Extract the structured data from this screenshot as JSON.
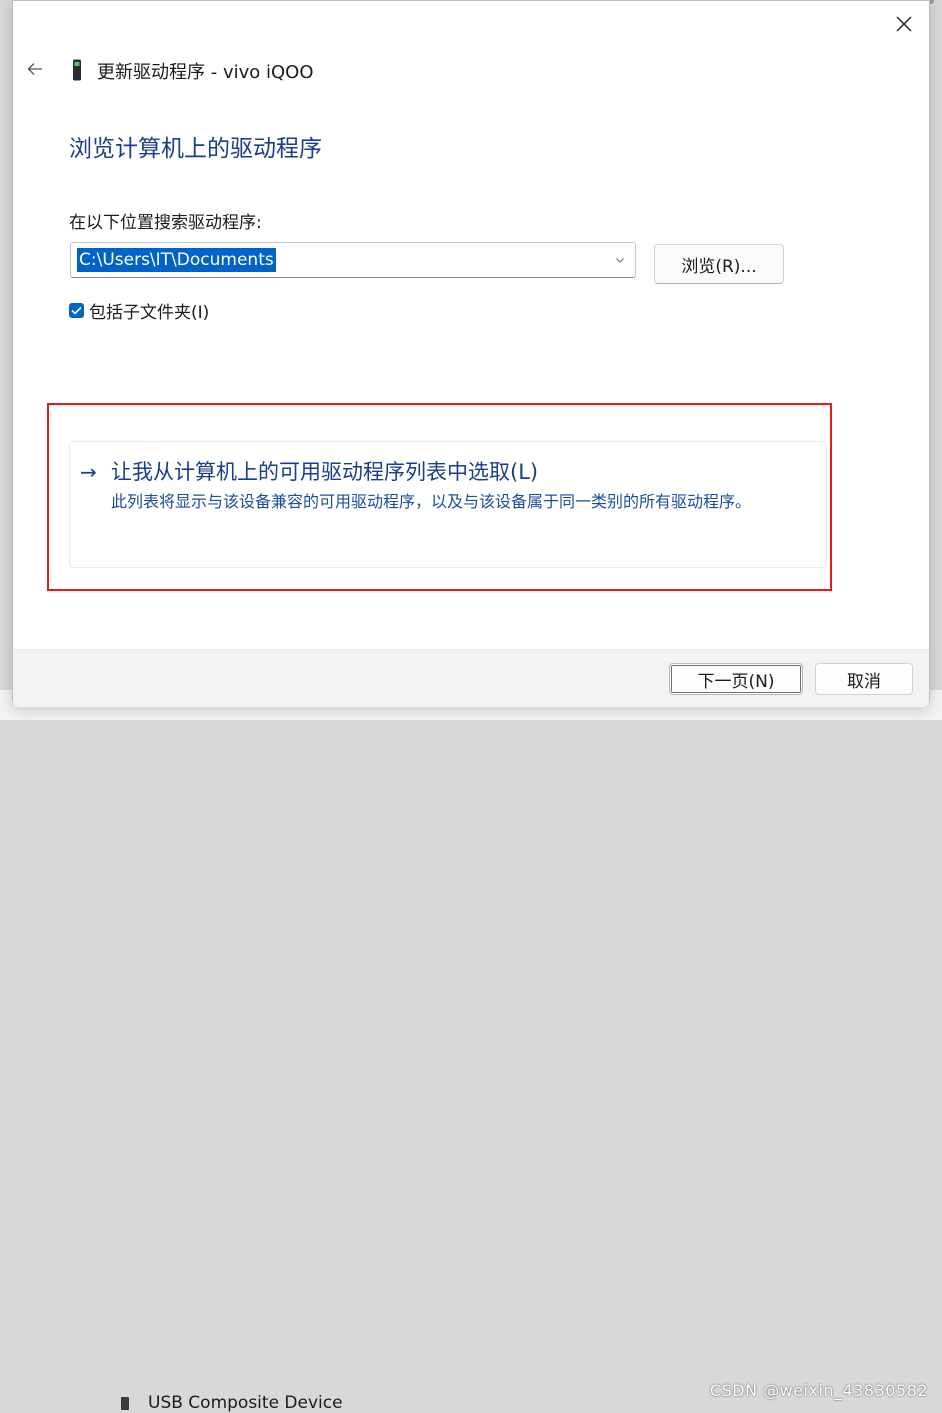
{
  "window": {
    "title": "更新驱动程序 - vivo iQOO"
  },
  "page": {
    "heading": "浏览计算机上的驱动程序",
    "search_label": "在以下位置搜索驱动程序:",
    "path_value": "C:\\Users\\IT\\Documents",
    "browse_label": "浏览(R)...",
    "include_subfolders_label": "包括子文件夹(I)",
    "include_subfolders_checked": true
  },
  "pick_option": {
    "arrow": "→",
    "title": "让我从计算机上的可用驱动程序列表中选取(L)",
    "description": "此列表将显示与该设备兼容的可用驱动程序，以及与该设备属于同一类别的所有驱动程序。"
  },
  "footer": {
    "next_label": "下一页(N)",
    "cancel_label": "取消"
  },
  "background": {
    "device_label": "USB Composite Device",
    "watermark": "CSDN @weixin_43830582"
  },
  "colors": {
    "accent": "#0067c0",
    "heading": "#1a3e8c",
    "annotation_box": "#e21b1b"
  },
  "icons": {
    "back": "arrow-left-icon",
    "close": "close-icon",
    "device": "phone-device-icon",
    "dropdown": "chevron-down-icon",
    "checkbox": "checkmark-icon"
  }
}
